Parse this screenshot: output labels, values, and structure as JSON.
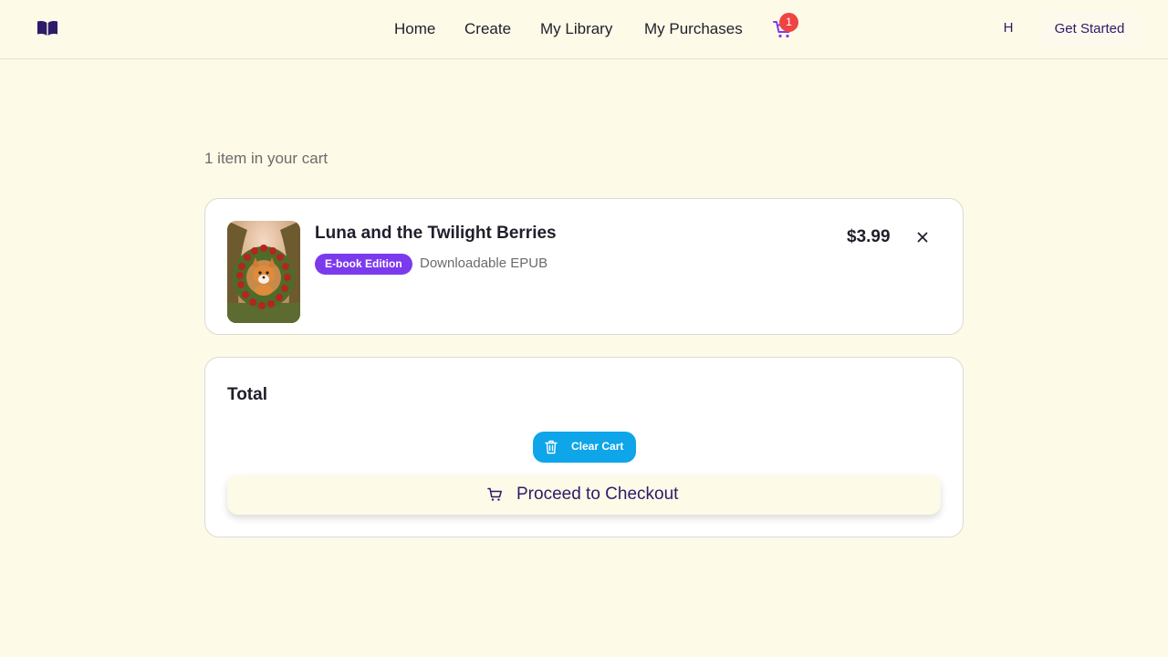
{
  "header": {
    "nav": [
      {
        "label": "Home"
      },
      {
        "label": "Create"
      },
      {
        "label": "My Library"
      },
      {
        "label": "My Purchases"
      }
    ],
    "cart_count": "1",
    "user_initial": "H",
    "cta_label": "Get Started",
    "icons": {
      "logo": "open-book-icon",
      "cart": "shopping-cart-icon"
    }
  },
  "cart": {
    "count_text": "1 item in your cart",
    "items": [
      {
        "title": "Luna and the Twilight Berries",
        "edition": "E-book Edition",
        "format": "Downloadable EPUB",
        "price": "$3.99"
      }
    ]
  },
  "summary": {
    "total_label": "Total",
    "clear_label": "Clear Cart",
    "checkout_label": "Proceed to Checkout"
  },
  "colors": {
    "background": "#fefae8",
    "accent_purple": "#7c3aed",
    "brand_dark": "#2d1b69",
    "badge_red": "#ef4444",
    "clear_blue": "#0ea5e9"
  }
}
